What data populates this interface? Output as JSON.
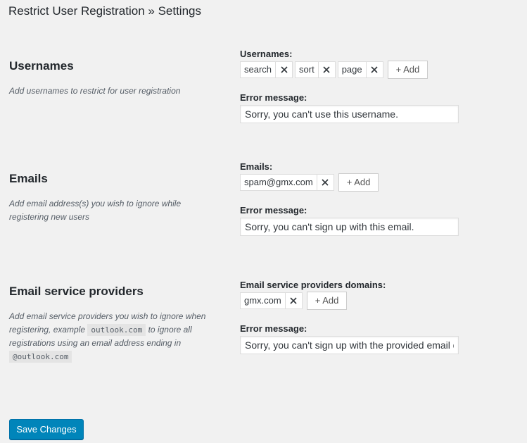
{
  "page_title": "Restrict User Registration » Settings",
  "sections": [
    {
      "title": "Usernames",
      "description": "Add usernames to restrict for user registration",
      "field_label": "Usernames:",
      "tags": [
        "search",
        "sort",
        "page"
      ],
      "add_label": "+ Add",
      "error_label": "Error message:",
      "error_value": "Sorry, you can't use this username."
    },
    {
      "title": "Emails",
      "description": "Add email address(s) you wish to ignore while registering new users",
      "field_label": "Emails:",
      "tags": [
        "spam@gmx.com"
      ],
      "add_label": "+ Add",
      "error_label": "Error message:",
      "error_value": "Sorry, you can't sign up with this email."
    },
    {
      "title": "Email service providers",
      "description_parts": {
        "before": "Add email service providers you wish to ignore when registering, example ",
        "code1": "outlook.com",
        "middle": " to ignore all registrations using an email address ending in ",
        "code2": "@outlook.com"
      },
      "field_label": "Email service providers domains:",
      "tags": [
        "gmx.com"
      ],
      "add_label": "+ Add",
      "error_label": "Error message:",
      "error_value": "Sorry, you can't sign up with the provided email domain."
    }
  ],
  "save_label": "Save Changes",
  "icons": {
    "remove": "close-icon"
  },
  "colors": {
    "primary": "#0085ba",
    "background": "#f1f1f1"
  }
}
